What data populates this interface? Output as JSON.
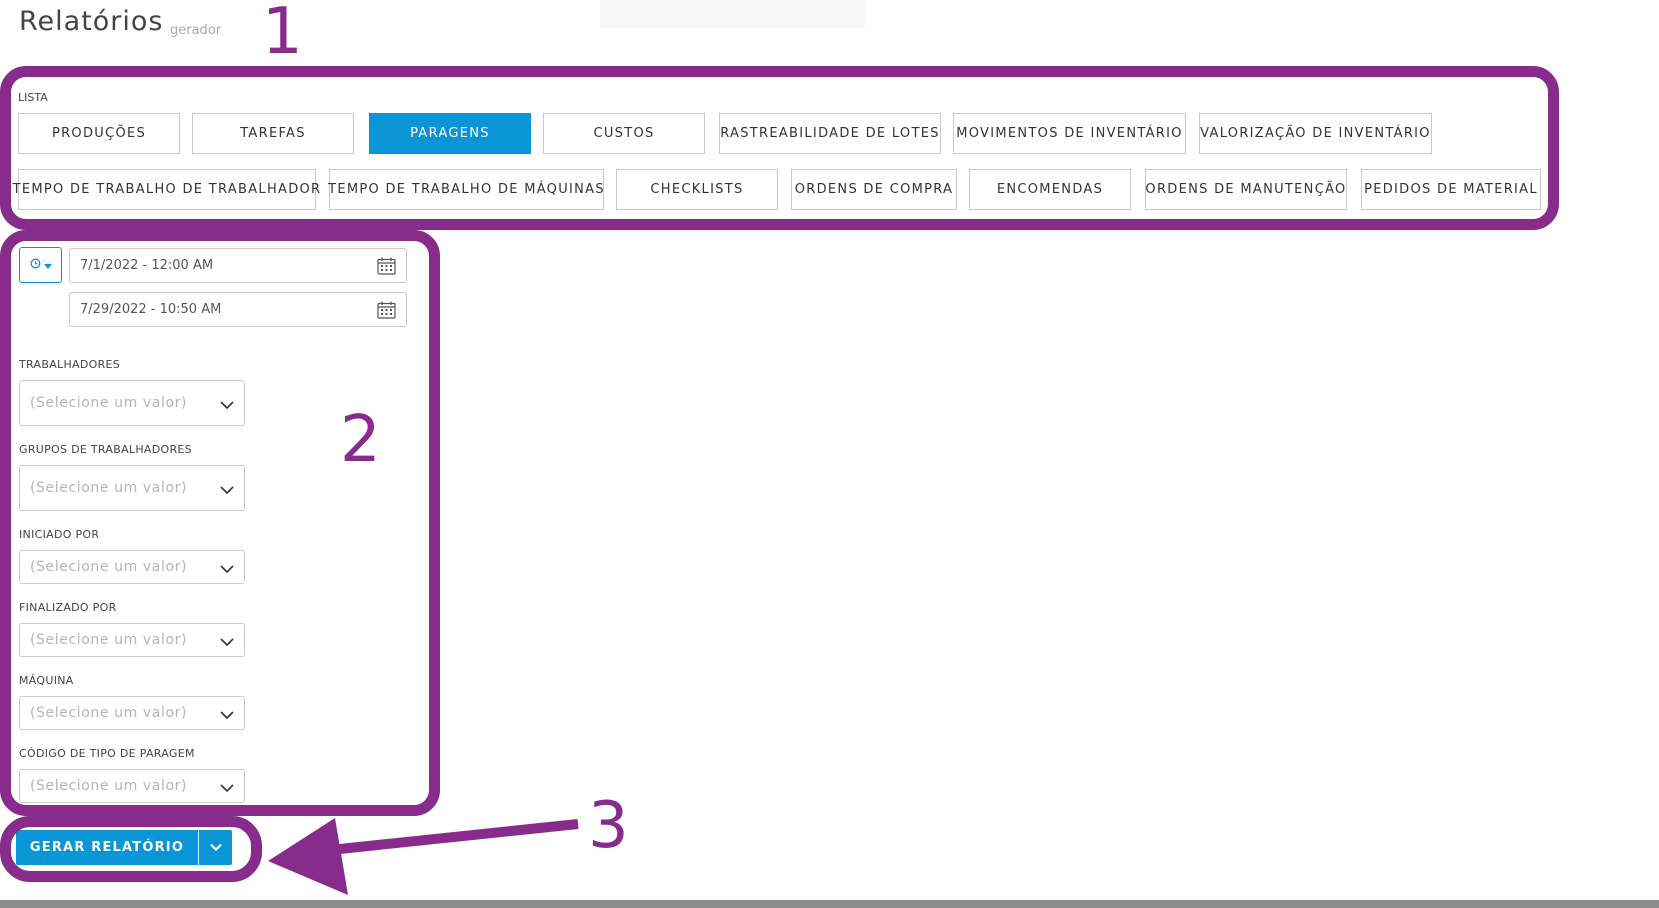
{
  "header": {
    "title": "Relatórios",
    "subtitle": "gerador"
  },
  "list": {
    "label": "LISTA",
    "row1": [
      "PRODUÇÕES",
      "TAREFAS",
      "PARAGENS",
      "CUSTOS",
      "RASTREABILIDADE DE LOTES",
      "MOVIMENTOS DE INVENTÁRIO",
      "VALORIZAÇÃO DE INVENTÁRIO"
    ],
    "row2": [
      "TEMPO DE TRABALHO DE TRABALHADOR",
      "TEMPO DE TRABALHO DE MÁQUINAS",
      "CHECKLISTS",
      "ORDENS DE COMPRA",
      "ENCOMENDAS",
      "ORDENS DE MANUTENÇÃO",
      "PEDIDOS DE MATERIAL"
    ],
    "active": "PARAGENS"
  },
  "filters": {
    "date_mode_icon": "clock-icon",
    "date_from": "7/1/2022 - 12:00 AM",
    "date_to": "7/29/2022 - 10:50 AM",
    "fields": [
      {
        "label": "TRABALHADORES",
        "placeholder": "(Selecione um valor)"
      },
      {
        "label": "GRUPOS DE TRABALHADORES",
        "placeholder": "(Selecione um valor)"
      },
      {
        "label": "INICIADO POR",
        "placeholder": "(Selecione um valor)"
      },
      {
        "label": "FINALIZADO POR",
        "placeholder": "(Selecione um valor)"
      },
      {
        "label": "MÁQUINA",
        "placeholder": "(Selecione um valor)"
      },
      {
        "label": "CÓDIGO DE TIPO DE PARAGEM",
        "placeholder": "(Selecione um valor)"
      }
    ]
  },
  "actions": {
    "generate_label": "GERAR RELATÓRIO"
  },
  "annotations": {
    "one": "1",
    "two": "2",
    "three": "3"
  },
  "colors": {
    "accent": "#0a95d6",
    "annotation": "#882c8c"
  }
}
